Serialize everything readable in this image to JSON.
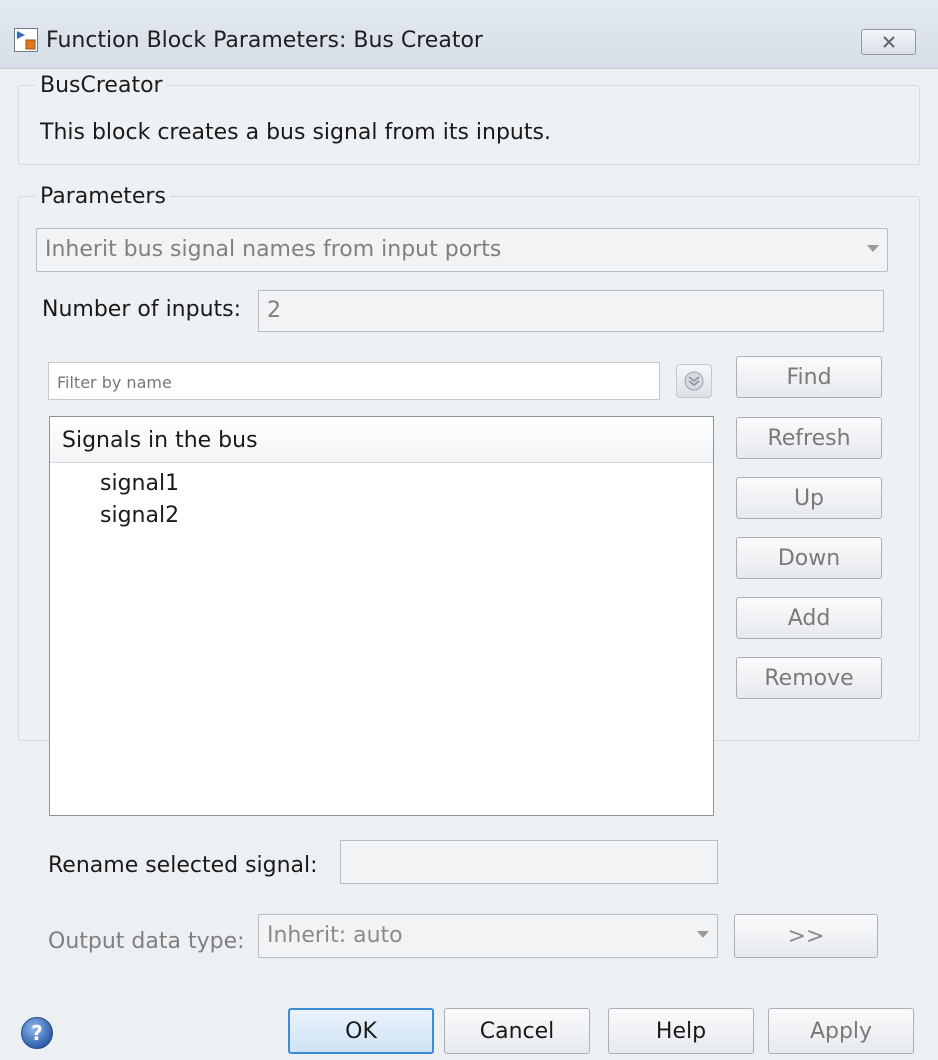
{
  "window": {
    "title": "Function Block Parameters: Bus Creator",
    "icon": "simulink-block-icon",
    "close_icon": "close-icon"
  },
  "block": {
    "group_title": "BusCreator",
    "description": "This block creates a bus signal from its inputs."
  },
  "parameters": {
    "group_title": "Parameters",
    "inherit_option": "Inherit bus signal names from input ports",
    "num_inputs_label": "Number of inputs:",
    "num_inputs_value": "2",
    "filter_placeholder": "Filter by name",
    "filter_options_icon": "double-chevron-down-icon",
    "signals_header": "Signals in the bus",
    "signals": [
      "signal1",
      "signal2"
    ],
    "buttons": {
      "find": "Find",
      "refresh": "Refresh",
      "up": "Up",
      "down": "Down",
      "add": "Add",
      "remove": "Remove"
    },
    "rename_label": "Rename selected signal:",
    "rename_value": "",
    "output_label": "Output data type:",
    "output_value": "Inherit: auto",
    "data_type_assistant": ">>"
  },
  "footer": {
    "help_icon": "help-icon",
    "ok": "OK",
    "cancel": "Cancel",
    "help": "Help",
    "apply": "Apply"
  },
  "colors": {
    "dialog_bg": "#edf0f3",
    "ok_border": "#3e8ad6",
    "disabled_text": "#7f7f7f"
  }
}
